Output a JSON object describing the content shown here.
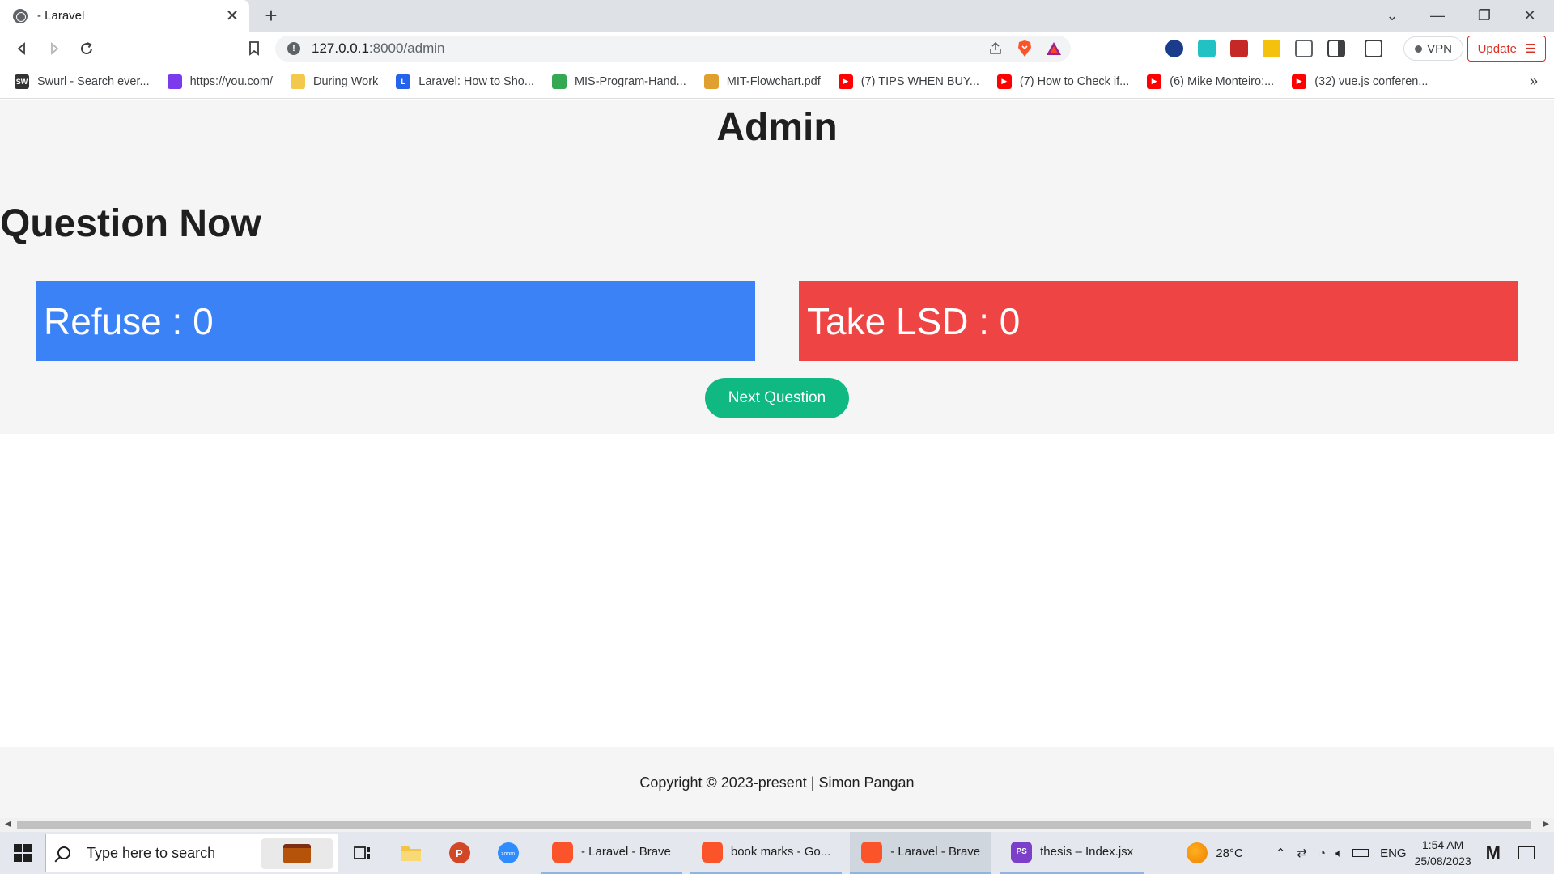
{
  "browser": {
    "tab_title": "- Laravel",
    "new_tab": "+",
    "url_host": "127.0.0.1",
    "url_path": ":8000/admin",
    "vpn_label": "VPN",
    "update_label": "Update"
  },
  "bookmarks": [
    {
      "label": "Swurl - Search ever...",
      "icon": "swurl-icon",
      "color": "#333333",
      "glyph": "SW"
    },
    {
      "label": "https://you.com/",
      "icon": "you-com-icon",
      "color": "#7c3aed",
      "glyph": ""
    },
    {
      "label": "During Work",
      "icon": "folder-icon",
      "color": "#f2c94c",
      "glyph": ""
    },
    {
      "label": "Laravel: How to Sho...",
      "icon": "laravel-docs-icon",
      "color": "#2563eb",
      "glyph": "L"
    },
    {
      "label": "MIS-Program-Hand...",
      "icon": "google-drive-icon",
      "color": "#34a853",
      "glyph": ""
    },
    {
      "label": "MIT-Flowchart.pdf",
      "icon": "pdf-icon",
      "color": "#e0a030",
      "glyph": ""
    },
    {
      "label": "(7) TIPS WHEN BUY...",
      "icon": "youtube-icon",
      "color": "#ff0000",
      "glyph": "▶"
    },
    {
      "label": "(7) How to Check if...",
      "icon": "youtube-icon",
      "color": "#ff0000",
      "glyph": "▶"
    },
    {
      "label": "(6) Mike Monteiro:...",
      "icon": "youtube-icon",
      "color": "#ff0000",
      "glyph": "▶"
    },
    {
      "label": "(32) vue.js conferen...",
      "icon": "youtube-icon",
      "color": "#ff0000",
      "glyph": "▶"
    }
  ],
  "bookmarks_more": "»",
  "page": {
    "header_title": "Admin",
    "question_title": "Question Now",
    "refuse_label": "Refuse : 0",
    "lsd_label": "Take LSD : 0",
    "next_button": "Next Question",
    "footer": "Copyright © 2023-present | Simon Pangan",
    "colors": {
      "refuse": "#3b82f6",
      "lsd": "#ef4444",
      "next": "#10b981"
    }
  },
  "taskbar": {
    "search_placeholder": "Type here to search",
    "apps": [
      {
        "label": "- Laravel - Brave",
        "icon": "brave-icon",
        "active": false
      },
      {
        "label": "book marks - Go...",
        "icon": "brave-icon",
        "active": false
      },
      {
        "label": "- Laravel - Brave",
        "icon": "brave-icon",
        "active": true
      },
      {
        "label": "thesis – Index.jsx",
        "icon": "phpstorm-icon",
        "active": false
      }
    ],
    "weather": "28°C",
    "language": "ENG",
    "time": "1:54 AM",
    "date": "25/08/2023"
  }
}
